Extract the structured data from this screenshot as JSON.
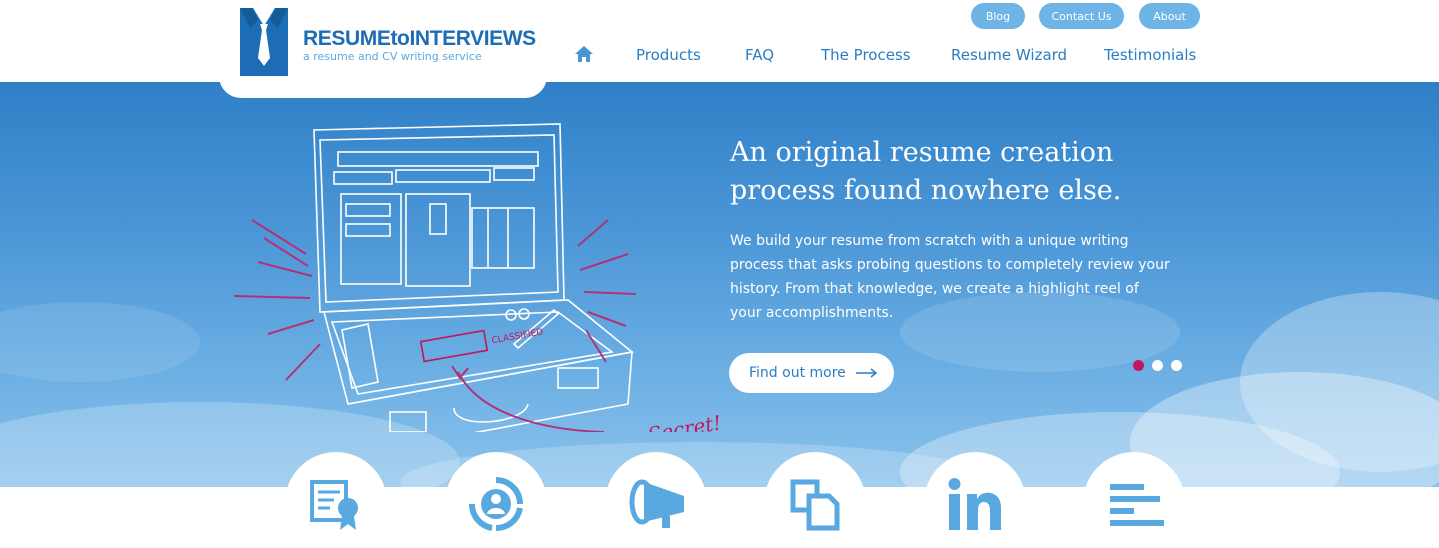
{
  "brand": {
    "name": "RESUMEtoINTERVIEWS",
    "tagline": "a resume and CV writing service",
    "color": "#1d6db6"
  },
  "top_links": {
    "blog": "Blog",
    "contact": "Contact Us",
    "about": "About"
  },
  "nav": {
    "home_icon": "home-icon",
    "items": [
      "Products",
      "FAQ",
      "The Process",
      "Resume Wizard",
      "Testimonials"
    ]
  },
  "hero": {
    "title_line1": "An original resume creation",
    "title_line2": "process found nowhere else.",
    "body": "We build your resume from scratch with a unique writing process that asks probing questions to completely review your history. From that knowledge, we create a highlight reel of your accomplishments.",
    "cta": "Find out more",
    "cta_icon": "arrow-right-icon",
    "illustration_stamp": "CLASSIFIED",
    "illustration_note": "Top Secret!",
    "slides": {
      "count": 3,
      "active": 1
    },
    "accent_color": "#c2185b"
  },
  "services": {
    "icons": [
      "certificate-icon",
      "person-cycle-icon",
      "megaphone-icon",
      "documents-icon",
      "linkedin-icon",
      "lines-icon"
    ],
    "color": "#5aa8e0"
  }
}
